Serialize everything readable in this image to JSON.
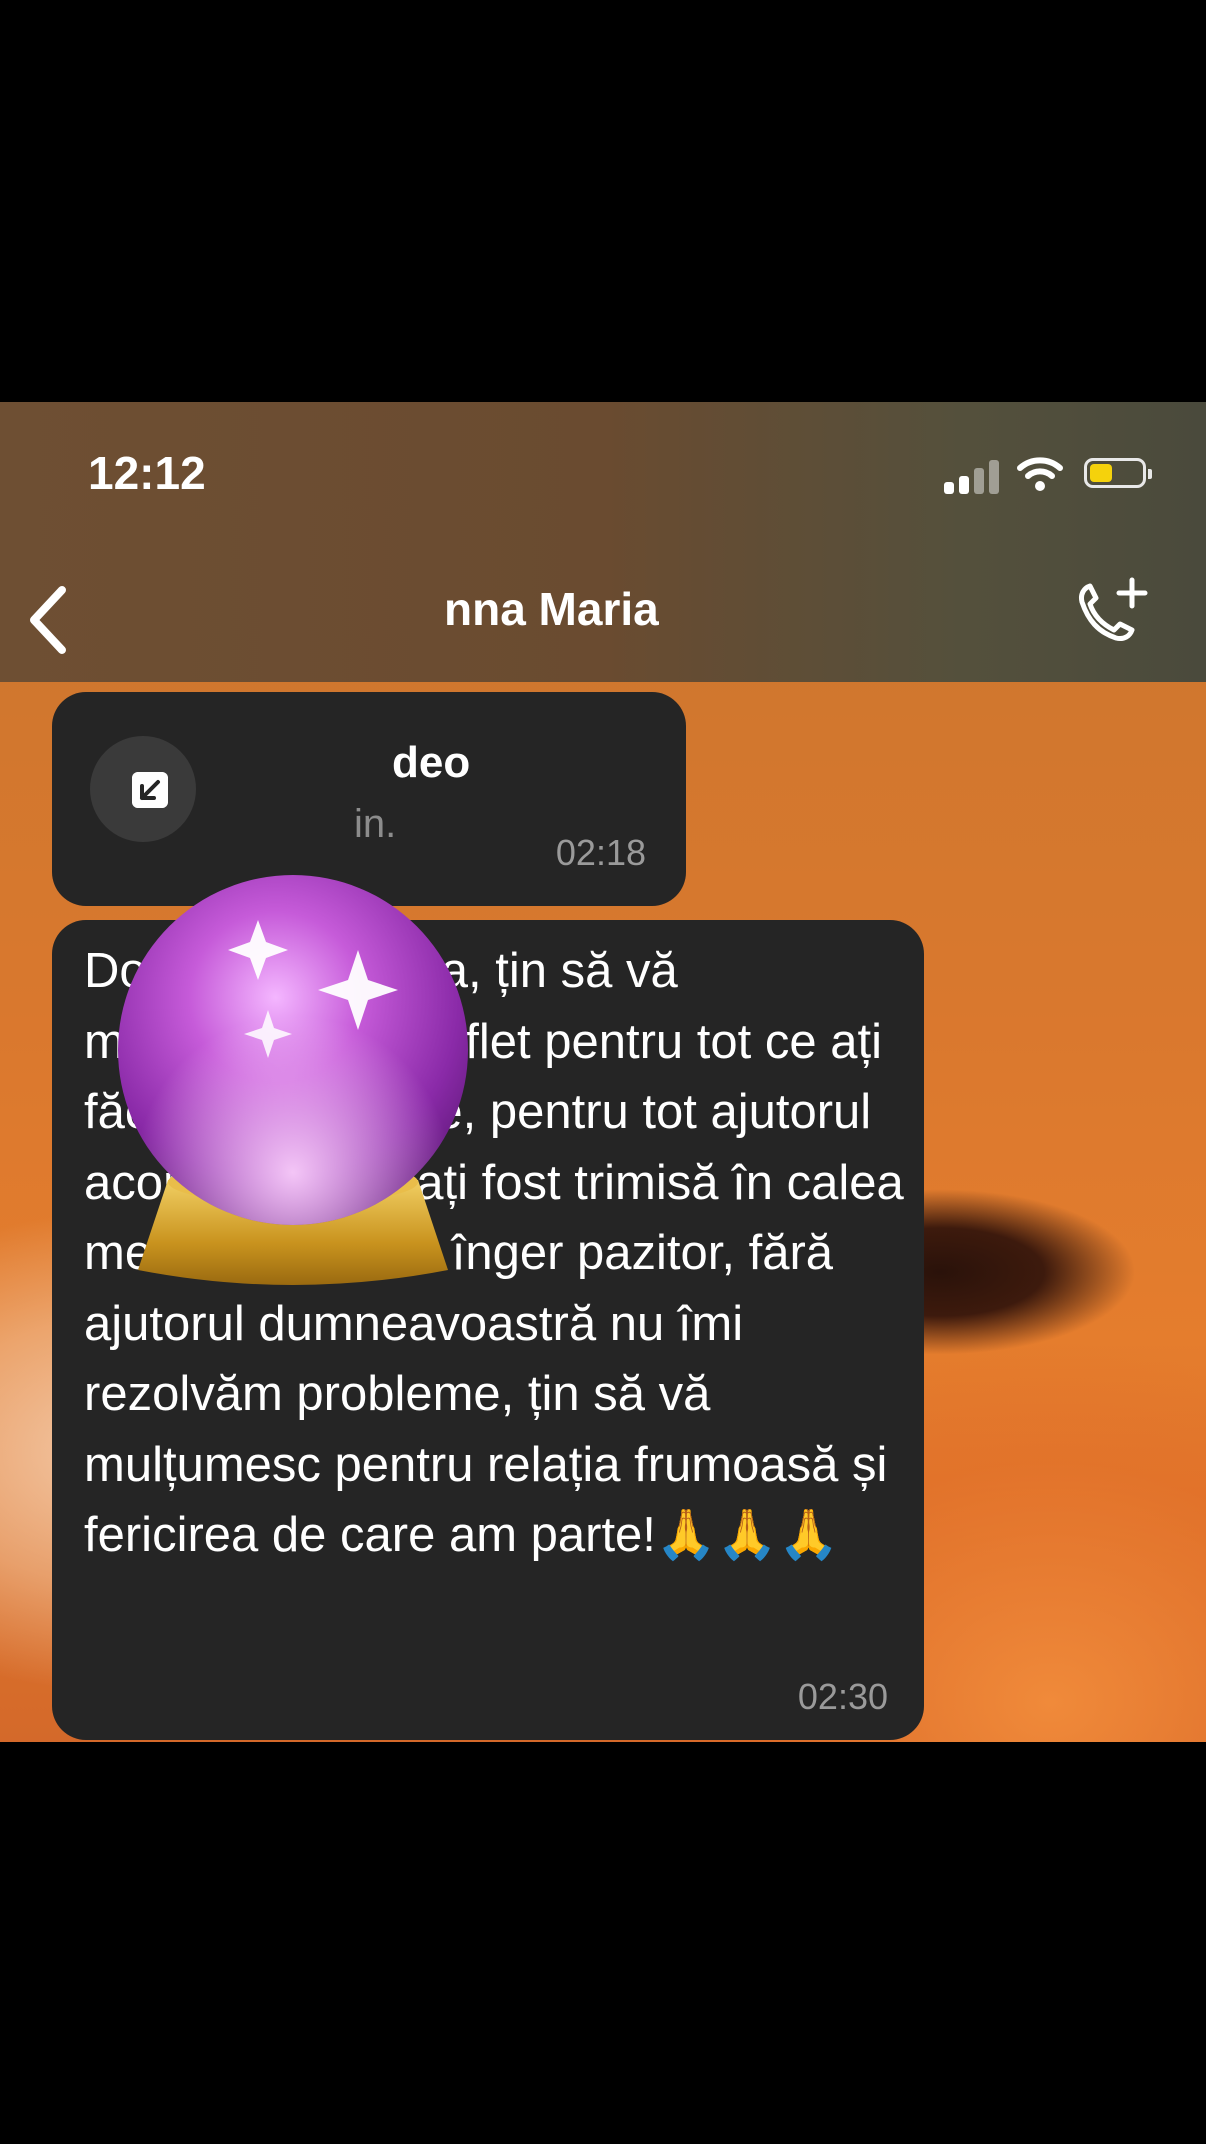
{
  "status_bar": {
    "time": "12:12"
  },
  "header": {
    "contact_name": "nna Maria"
  },
  "call_message": {
    "title": "deo",
    "subtitle": "in.",
    "time": "02:18"
  },
  "text_message": {
    "text": "Doamna Gabriela, țin să vă mulțumesc din suflet pentru tot ce ați făcut pentru mine, pentru tot ajutorul acordat! Parcă ați fost trimisă în calea mea de către un înger pazitor, fără ajutorul dumneavoastră nu îmi rezolvăm probleme, țin să vă mulțumesc pentru relația frumoasă și fericirea de care am parte!🙏🙏🙏",
    "time": "02:30"
  },
  "colors": {
    "bubble": "#252525",
    "battery": "#f5d20c",
    "header": "#6e4f33"
  },
  "icons": [
    "back-chevron-icon",
    "add-call-icon",
    "signal-icon",
    "wifi-icon",
    "battery-icon",
    "crystal-ball-icon"
  ]
}
